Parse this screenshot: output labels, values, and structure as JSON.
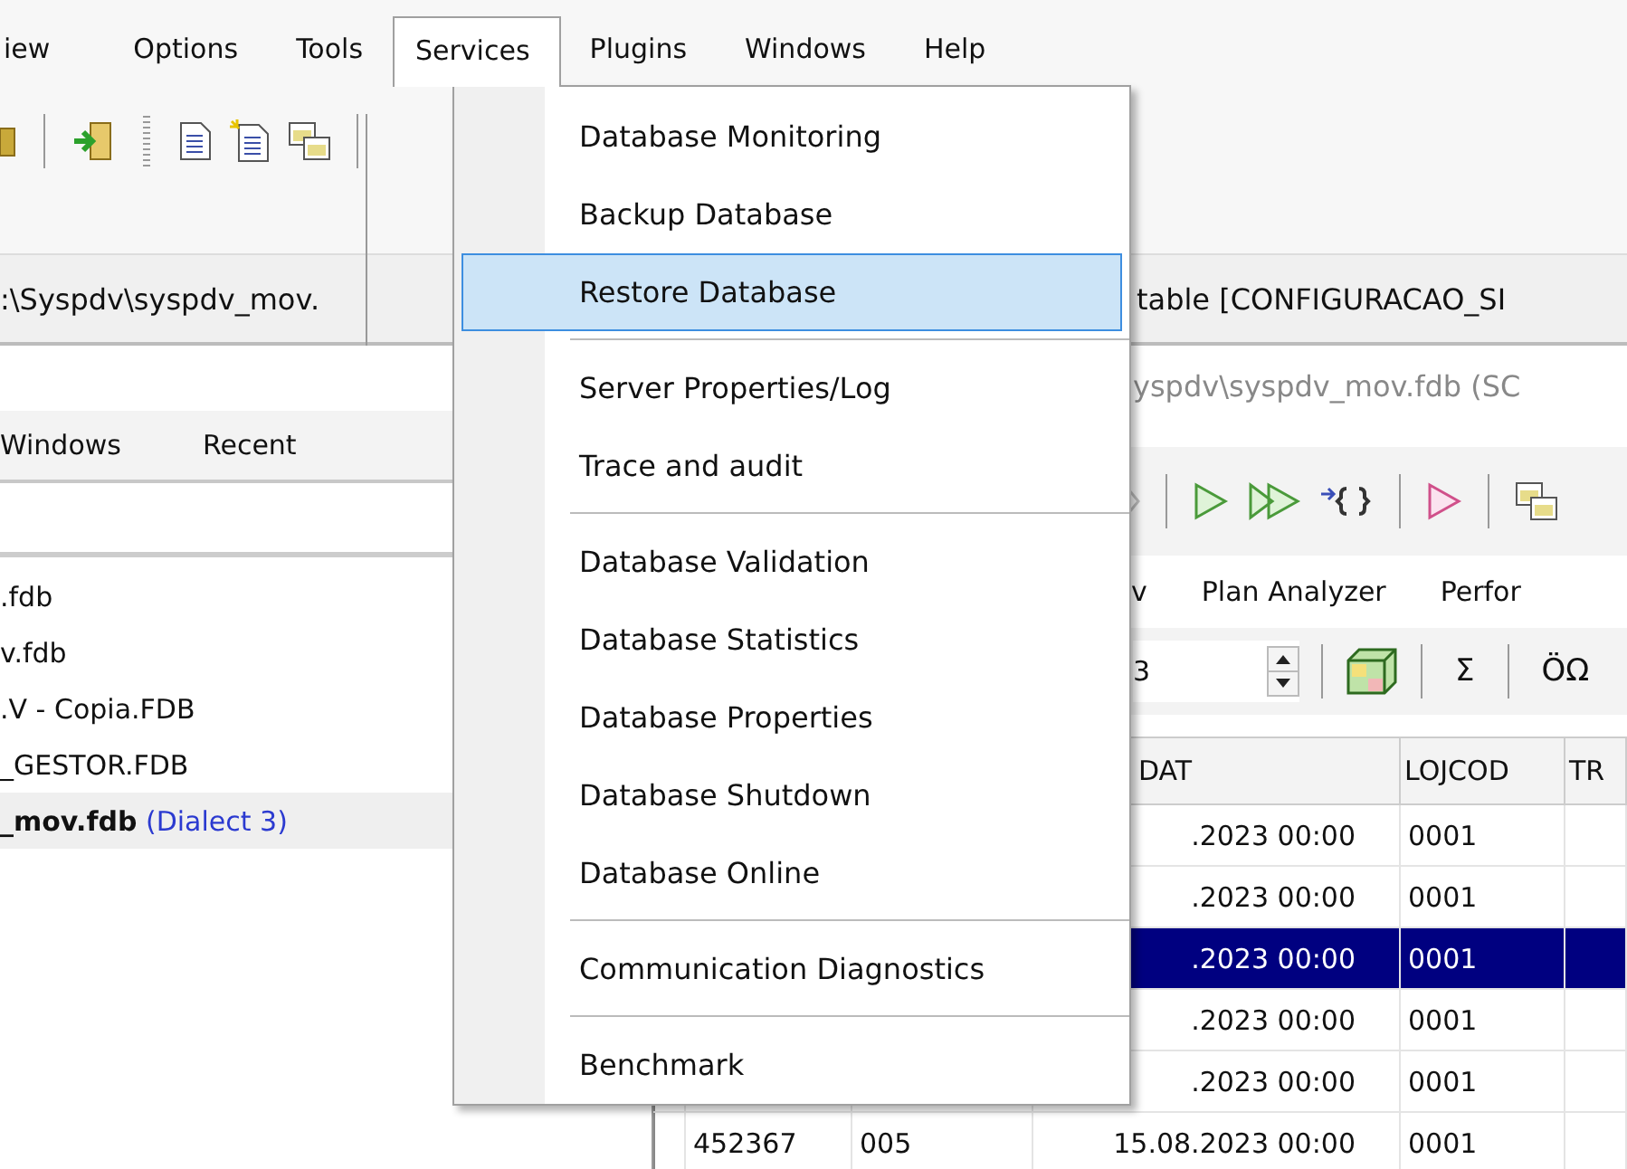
{
  "menubar": [
    {
      "label": "iew",
      "selected": false
    },
    {
      "label": "Options",
      "selected": false
    },
    {
      "label": "Tools",
      "selected": false
    },
    {
      "label": "Services",
      "selected": true
    },
    {
      "label": "Plugins",
      "selected": false
    },
    {
      "label": "Windows",
      "selected": false
    },
    {
      "label": "Help",
      "selected": false
    }
  ],
  "menu": {
    "groups": [
      [
        {
          "label": "Database Monitoring",
          "selected": false
        },
        {
          "label": "Backup Database",
          "selected": false
        },
        {
          "label": "Restore Database",
          "selected": true
        }
      ],
      [
        {
          "label": "Server Properties/Log",
          "selected": false
        },
        {
          "label": "Trace and audit",
          "selected": false
        }
      ],
      [
        {
          "label": "Database Validation",
          "selected": false
        },
        {
          "label": "Database Statistics",
          "selected": false
        },
        {
          "label": "Database Properties",
          "selected": false
        },
        {
          "label": "Database Shutdown",
          "selected": false
        },
        {
          "label": "Database Online",
          "selected": false
        }
      ],
      [
        {
          "label": "Communication Diagnostics",
          "selected": false
        }
      ],
      [
        {
          "label": "Benchmark",
          "selected": false
        }
      ]
    ]
  },
  "path_bar": {
    "path": ":\\Syspdv\\syspdv_mov.",
    "table_title": "table [CONFIGURACAO_SI"
  },
  "left_panel": {
    "tabs": [
      {
        "label": "Windows",
        "selected": false
      },
      {
        "label": "Recent",
        "selected": false
      }
    ],
    "databases": [
      {
        "file": ".fdb",
        "selected": false
      },
      {
        "file": "v.fdb",
        "selected": false
      },
      {
        "file": ".V - Copia.FDB",
        "selected": false
      },
      {
        "file": "_GESTOR.FDB",
        "selected": false
      },
      {
        "file": "_mov.fdb",
        "dialect": "(Dialect 3)",
        "selected": true
      }
    ]
  },
  "editor": {
    "title": "yspdv\\syspdv_mov.fdb (SC",
    "tabs": [
      {
        "label": "v",
        "selected": false
      },
      {
        "label": "Plan Analyzer",
        "selected": false
      },
      {
        "label": "Perfor",
        "selected": false
      }
    ],
    "page_field": {
      "value": "3"
    },
    "toolbar_labels": [
      "Σ",
      "ÖΩ"
    ],
    "grid": {
      "columns": [
        "DAT",
        "LOJCOD",
        "TR"
      ],
      "rows": [
        {
          "dat": ".2023 00:00",
          "lojcod": "0001",
          "selected": false
        },
        {
          "dat": ".2023 00:00",
          "lojcod": "0001",
          "selected": false
        },
        {
          "dat": ".2023 00:00",
          "lojcod": "0001",
          "selected": true
        },
        {
          "dat": ".2023 00:00",
          "lojcod": "0001",
          "selected": false
        },
        {
          "dat": ".2023 00:00",
          "lojcod": "0001",
          "selected": false
        },
        {
          "col_1": "452367",
          "col_2": "005",
          "dat": "15.08.2023 00:00",
          "lojcod": "0001",
          "selected": false
        }
      ]
    }
  }
}
